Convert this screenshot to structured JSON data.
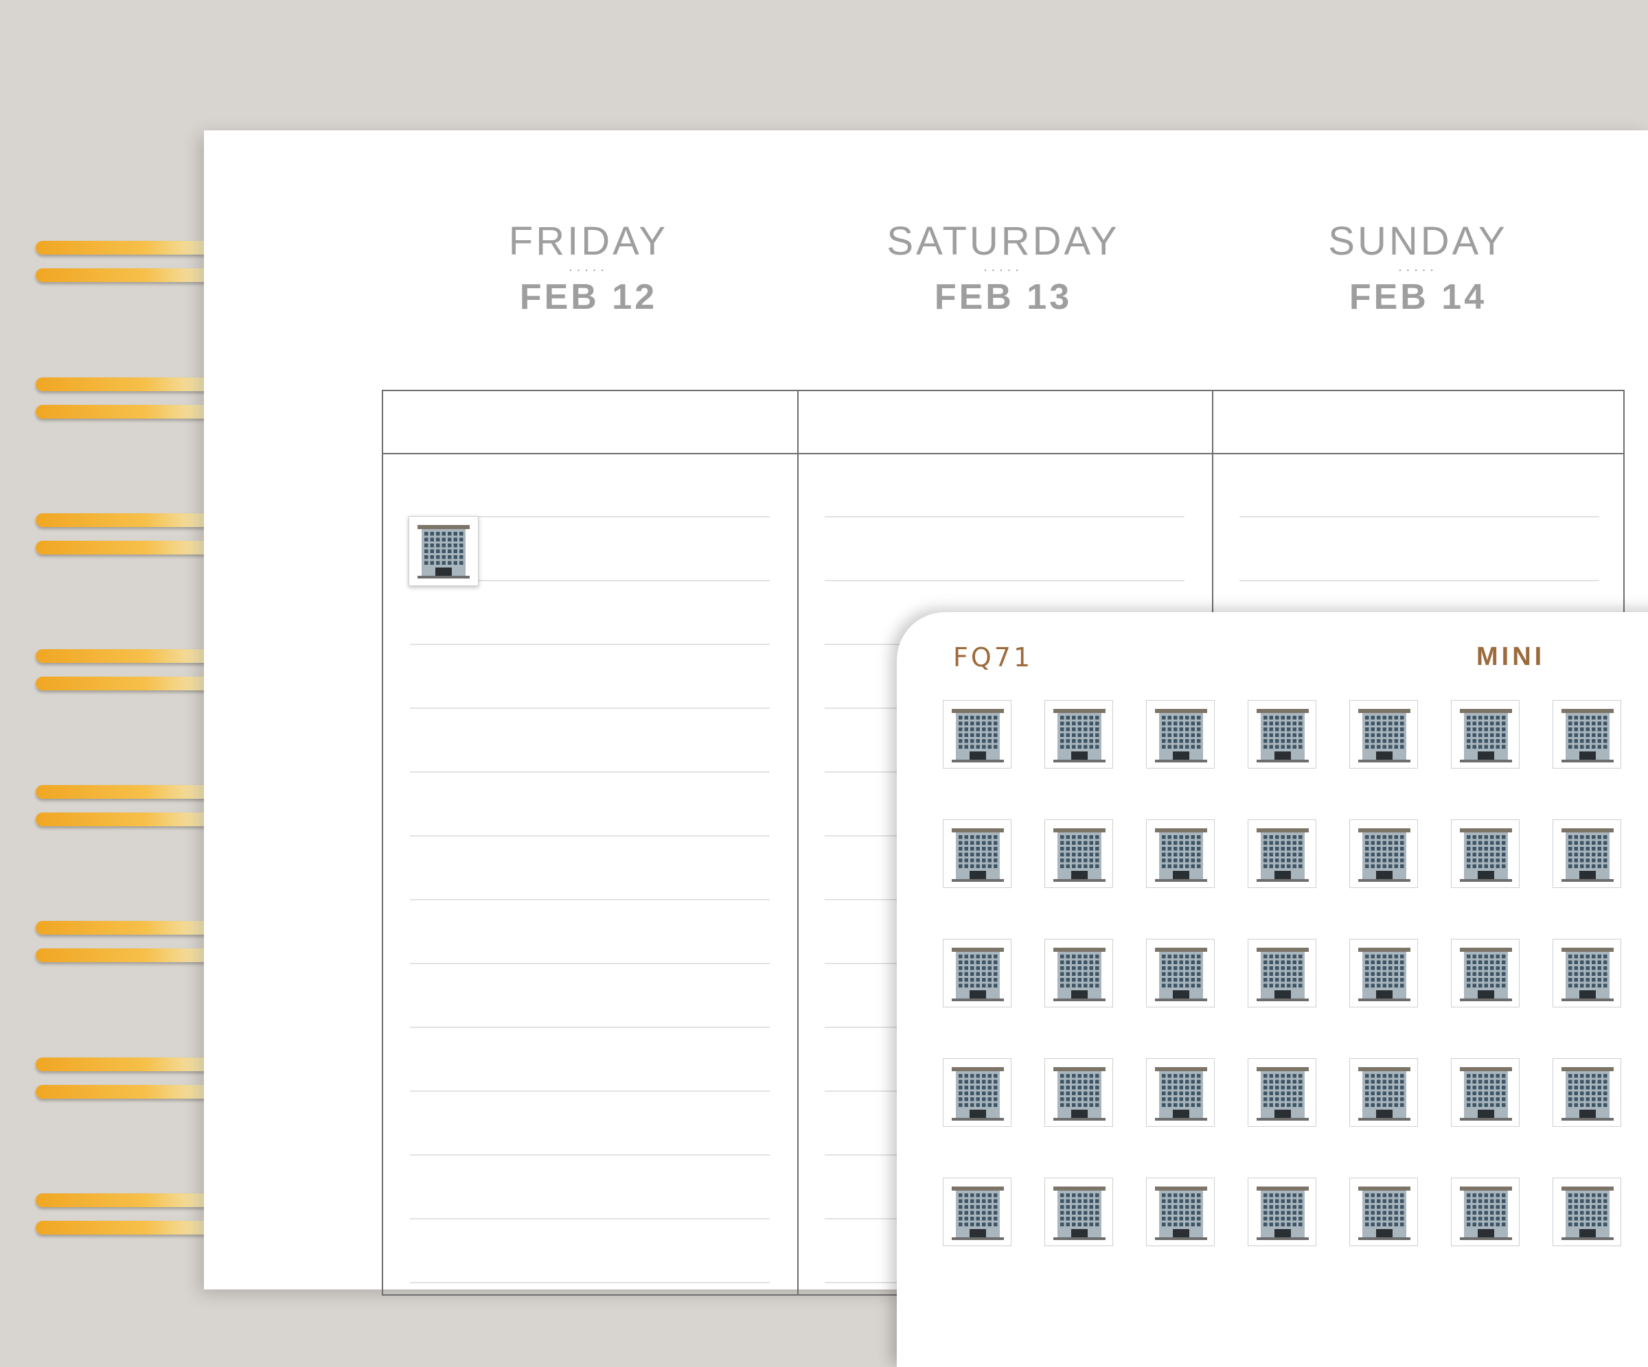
{
  "planner": {
    "days": [
      {
        "name": "FRIDAY",
        "dots": ".....",
        "date": "FEB 12"
      },
      {
        "name": "SATURDAY",
        "dots": ".....",
        "date": "FEB 13"
      },
      {
        "name": "SUNDAY",
        "dots": ".....",
        "date": "FEB 14"
      }
    ],
    "placed_sticker_icon": "office-building-icon"
  },
  "sticker_sheet": {
    "code": "FQ71",
    "size": "MINI",
    "icon": "office-building-icon",
    "rows": 5,
    "cols": 7
  },
  "colors": {
    "background": "#d8d4cf",
    "ring_gold": "#f0a623",
    "label_brown": "#9c6b3c",
    "header_gray": "#9e9e9e"
  }
}
